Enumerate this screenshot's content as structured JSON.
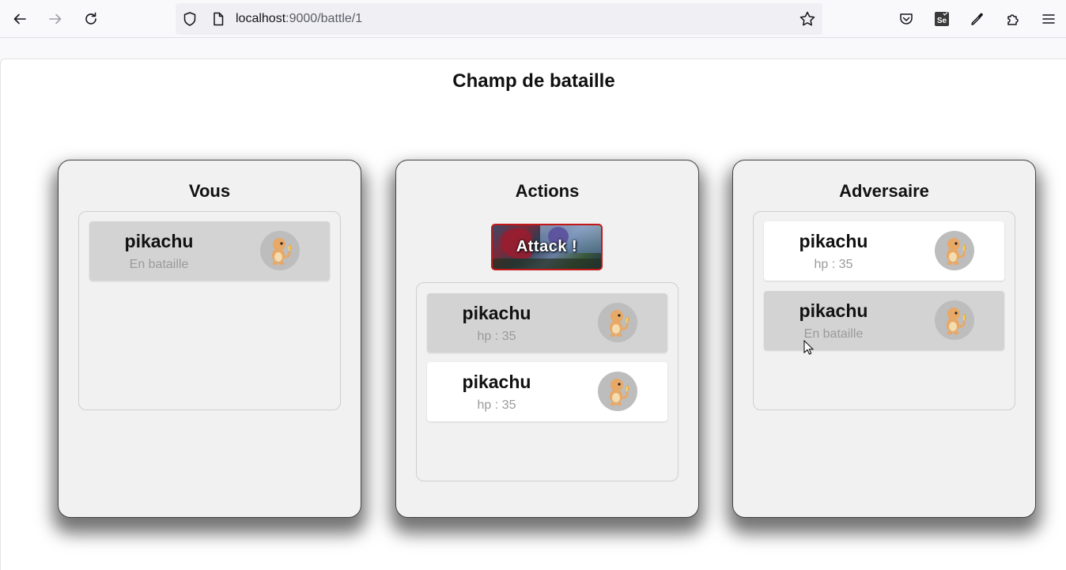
{
  "browser": {
    "url_host": "localhost",
    "url_path": ":9000/battle/1"
  },
  "page": {
    "title": "Champ de bataille"
  },
  "panels": {
    "you": {
      "title": "Vous",
      "cards": [
        {
          "name": "pikachu",
          "sub": "En bataille",
          "state": "grey"
        }
      ]
    },
    "actions": {
      "title": "Actions",
      "attack_label": "Attack !",
      "cards": [
        {
          "name": "pikachu",
          "sub": "hp : 35",
          "state": "grey"
        },
        {
          "name": "pikachu",
          "sub": "hp : 35",
          "state": "white"
        }
      ]
    },
    "opponent": {
      "title": "Adversaire",
      "cards": [
        {
          "name": "pikachu",
          "sub": "hp : 35",
          "state": "white"
        },
        {
          "name": "pikachu",
          "sub": "En bataille",
          "state": "grey"
        }
      ]
    }
  },
  "icons": {
    "back": "arrow-left-icon",
    "forward": "arrow-right-icon",
    "reload": "reload-icon",
    "shield": "shield-icon",
    "page": "page-icon",
    "star": "star-icon",
    "pocket": "pocket-icon",
    "selenium": "selenium-icon",
    "eyedropper": "eyedropper-icon",
    "extensions": "puzzle-icon",
    "menu": "hamburger-menu-icon",
    "avatar": "charmander-icon"
  },
  "colors": {
    "attack_border": "#c21818",
    "card_selected": "#d3d3d3",
    "card_default": "#ffffff",
    "panel_bg": "#f1f1f1"
  }
}
